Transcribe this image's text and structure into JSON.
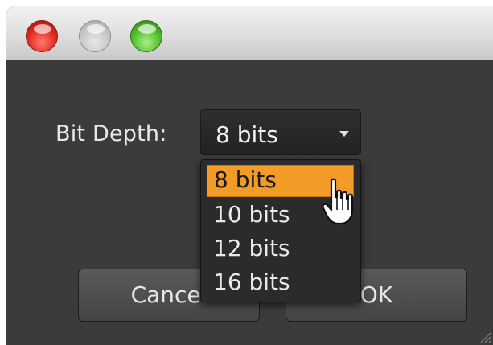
{
  "window": {
    "controls": {
      "close_icon": "close-icon",
      "minimize_icon": "minimize-icon",
      "zoom_icon": "zoom-icon"
    }
  },
  "bit_depth": {
    "label": "Bit Depth:",
    "selected": "8 bits",
    "options": [
      "8 bits",
      "10 bits",
      "12 bits",
      "16 bits"
    ],
    "highlighted_index": 0
  },
  "buttons": {
    "cancel_label": "Cancel",
    "ok_label": "OK"
  },
  "colors": {
    "highlight": "#f29b26",
    "window_bg": "#3b3b3b"
  }
}
